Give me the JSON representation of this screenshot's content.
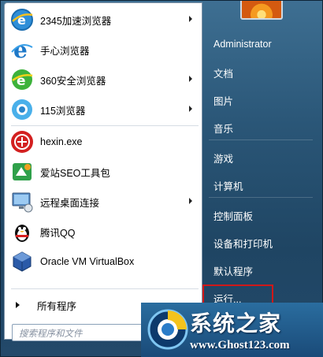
{
  "pinned": [
    {
      "label": "2345加速浏览器",
      "icon": "browser-2345-icon",
      "has_submenu": true
    },
    {
      "label": "手心浏览器",
      "icon": "browser-shouxin-icon",
      "has_submenu": false
    },
    {
      "label": "360安全浏览器",
      "icon": "browser-360-icon",
      "has_submenu": true
    },
    {
      "label": "115浏览器",
      "icon": "browser-115-icon",
      "has_submenu": true
    }
  ],
  "recent": [
    {
      "label": "hexin.exe",
      "icon": "hexin-icon",
      "has_submenu": false
    },
    {
      "label": "爱站SEO工具包",
      "icon": "aizhan-seo-icon",
      "has_submenu": false
    },
    {
      "label": "远程桌面连接",
      "icon": "remote-desktop-icon",
      "has_submenu": true
    },
    {
      "label": "腾讯QQ",
      "icon": "qq-penguin-icon",
      "has_submenu": false
    },
    {
      "label": "Oracle VM VirtualBox",
      "icon": "virtualbox-icon",
      "has_submenu": false
    }
  ],
  "all_programs": "所有程序",
  "search_placeholder": "搜索程序和文件",
  "right": {
    "user": "Administrator",
    "items": [
      "文档",
      "图片",
      "音乐",
      "游戏",
      "计算机",
      "控制面板",
      "设备和打印机",
      "默认程序",
      "运行..."
    ]
  },
  "watermark": {
    "title": "系统之家",
    "url": "www.Ghost123.com"
  }
}
